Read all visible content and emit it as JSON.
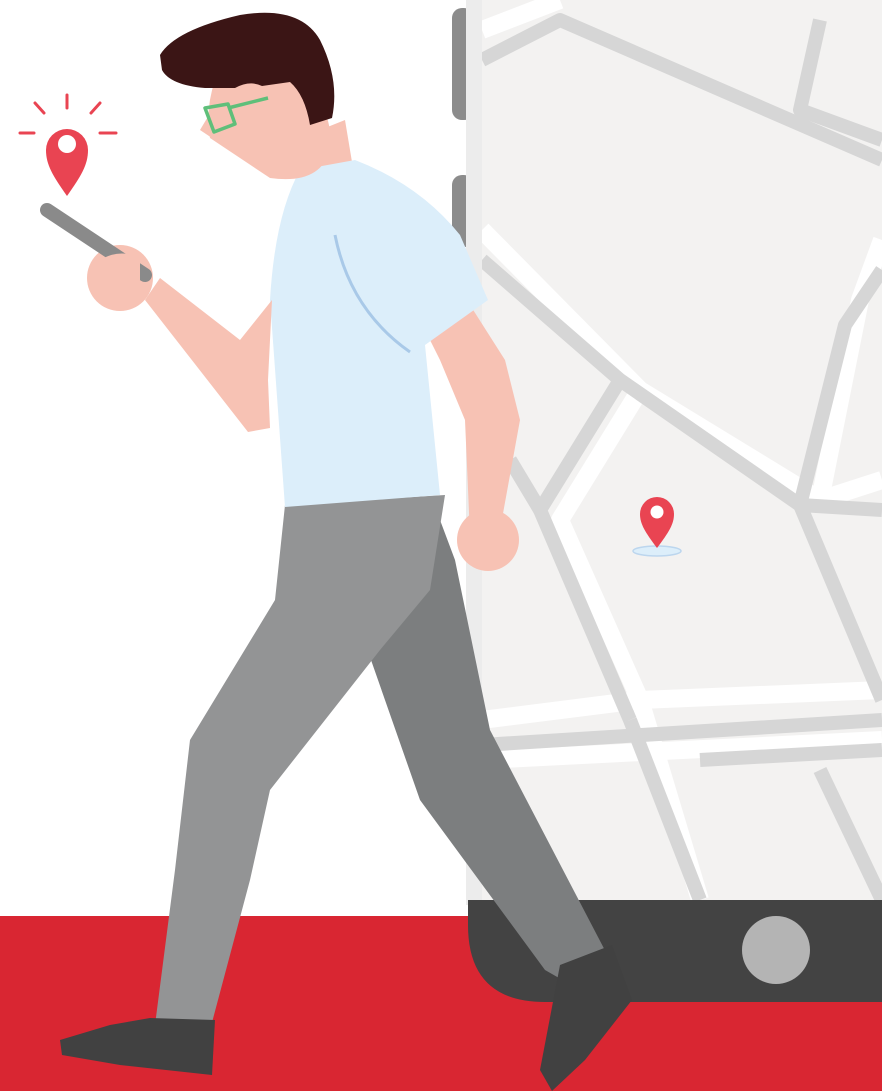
{
  "illustration": {
    "subject": "person-walking-with-phone",
    "icons": [
      "location-pin-icon",
      "map-pin-icon",
      "smartphone-icon"
    ],
    "colors": {
      "background": "#ffffff",
      "floor": "#d92632",
      "pin": "#e94452",
      "map_fill": "#f3f2f1",
      "map_road": "#d6d6d6",
      "device_dark": "#434343",
      "shirt": "#dceefa",
      "skin": "#f7c2b4",
      "hair": "#3b1515",
      "pants": "#939495",
      "pants_back": "#7c7e7f",
      "shoe": "#414141",
      "glasses": "#5fbf7a"
    }
  }
}
